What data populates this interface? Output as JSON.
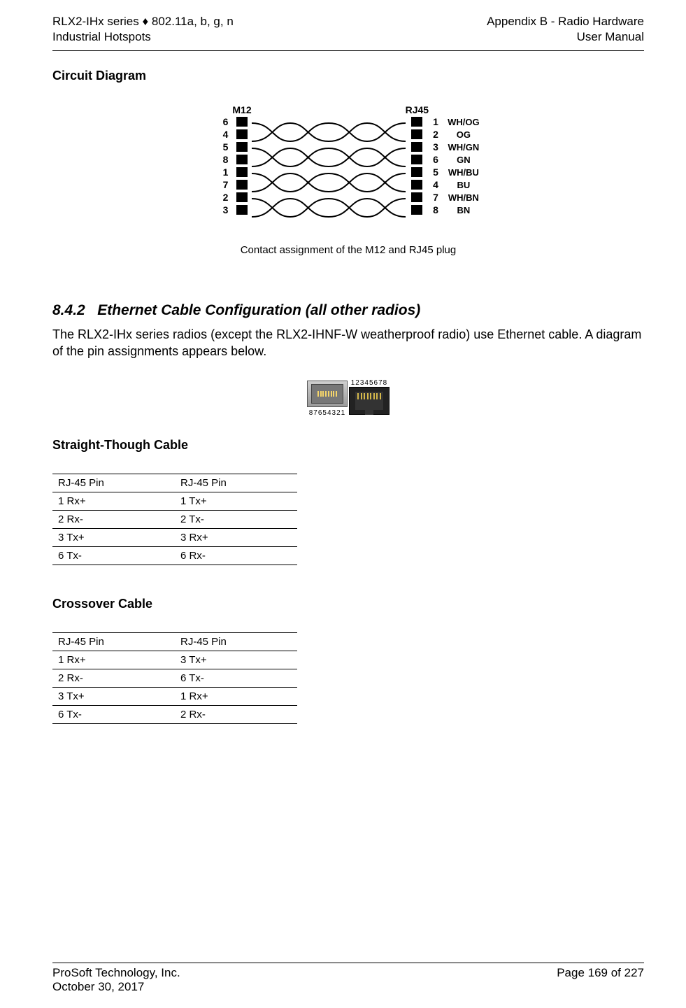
{
  "header": {
    "left1": "RLX2-IHx series ♦ 802.11a, b, g, n",
    "left2": "Industrial Hotspots",
    "right1": "Appendix B - Radio Hardware",
    "right2": "User Manual"
  },
  "circuit": {
    "heading": "Circuit Diagram",
    "label_left": "M12",
    "label_right": "RJ45",
    "rows": [
      {
        "lpin": "6",
        "rpin": "1",
        "color": "WH/OG"
      },
      {
        "lpin": "4",
        "rpin": "2",
        "color": "OG"
      },
      {
        "lpin": "5",
        "rpin": "3",
        "color": "WH/GN"
      },
      {
        "lpin": "8",
        "rpin": "6",
        "color": "GN"
      },
      {
        "lpin": "1",
        "rpin": "5",
        "color": "WH/BU"
      },
      {
        "lpin": "7",
        "rpin": "4",
        "color": "BU"
      },
      {
        "lpin": "2",
        "rpin": "7",
        "color": "WH/BN"
      },
      {
        "lpin": "3",
        "rpin": "8",
        "color": "BN"
      }
    ],
    "caption": "Contact assignment of the M12 and RJ45 plug"
  },
  "section": {
    "num": "8.4.2",
    "title": "Ethernet Cable Configuration (all other radios)",
    "body": "The RLX2-IHx series radios (except the RLX2-IHNF-W weatherproof radio) use Ethernet cable. A diagram of the pin assignments appears below."
  },
  "rj": {
    "top": "12345678",
    "bottom": "87654321"
  },
  "straight": {
    "heading": "Straight-Though Cable",
    "col1": "RJ-45 Pin",
    "col2": "RJ-45 Pin",
    "rows": [
      [
        "1 Rx+",
        "1 Tx+"
      ],
      [
        "2 Rx-",
        "2 Tx-"
      ],
      [
        "3 Tx+",
        "3 Rx+"
      ],
      [
        "6 Tx-",
        "6 Rx-"
      ]
    ]
  },
  "crossover": {
    "heading": "Crossover Cable",
    "col1": "RJ-45 Pin",
    "col2": "RJ-45 Pin",
    "rows": [
      [
        "1 Rx+",
        "3 Tx+"
      ],
      [
        "2 Rx-",
        "6 Tx-"
      ],
      [
        "3 Tx+",
        "1 Rx+"
      ],
      [
        "6 Tx-",
        "2 Rx-"
      ]
    ]
  },
  "footer": {
    "left1": "ProSoft Technology, Inc.",
    "left2": "October 30, 2017",
    "right": "Page 169 of 227"
  }
}
